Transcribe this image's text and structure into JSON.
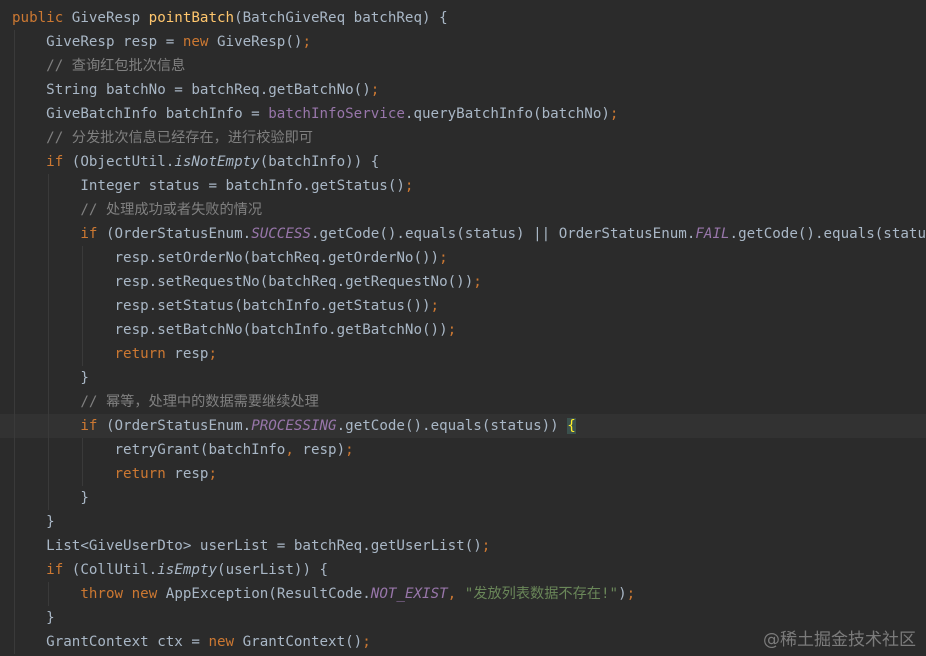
{
  "code_lines": [
    "public GiveResp pointBatch(BatchGiveReq batchReq) {",
    "    GiveResp resp = new GiveResp();",
    "    // 查询红包批次信息",
    "    String batchNo = batchReq.getBatchNo();",
    "    GiveBatchInfo batchInfo = batchInfoService.queryBatchInfo(batchNo);",
    "    // 分发批次信息已经存在，进行校验即可",
    "    if (ObjectUtil.isNotEmpty(batchInfo)) {",
    "        Integer status = batchInfo.getStatus();",
    "        // 处理成功或者失败的情况",
    "        if (OrderStatusEnum.SUCCESS.getCode().equals(status) || OrderStatusEnum.FAIL.getCode().equals(status)) {",
    "            resp.setOrderNo(batchReq.getOrderNo());",
    "            resp.setRequestNo(batchReq.getRequestNo());",
    "            resp.setStatus(batchInfo.getStatus());",
    "            resp.setBatchNo(batchInfo.getBatchNo());",
    "            return resp;",
    "        }",
    "        // 幂等，处理中的数据需要继续处理",
    "        if (OrderStatusEnum.PROCESSING.getCode().equals(status)) {",
    "            retryGrant(batchInfo, resp);",
    "            return resp;",
    "        }",
    "    }",
    "    List<GiveUserDto> userList = batchReq.getUserList();",
    "    if (CollUtil.isEmpty(userList)) {",
    "        throw new AppException(ResultCode.NOT_EXIST, \"发放列表数据不存在!\");",
    "    }",
    "    GrantContext ctx = new GrantContext();"
  ],
  "watermark": "@稀土掘金技术社区",
  "colors": {
    "background": "#2b2b2b",
    "default": "#a9b7c6",
    "keyword": "#cc7832",
    "function": "#ffc66d",
    "comment": "#808080",
    "field": "#9876aa",
    "string": "#6a8759",
    "current_line": "#323232"
  },
  "current_line_index": 17
}
